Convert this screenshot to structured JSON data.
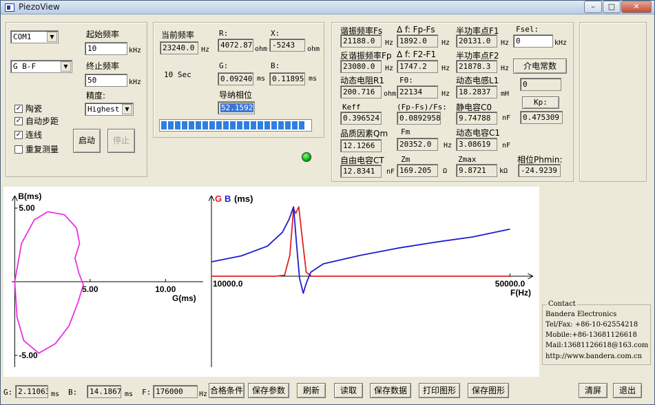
{
  "window": {
    "title": "PiezoView",
    "minimize": "–",
    "maximize": "□",
    "close": "✕"
  },
  "left": {
    "port": "COM1",
    "mode": "G B-F",
    "start_label": "起始频率",
    "start_value": "10",
    "start_unit": "kHz",
    "end_label": "终止频率",
    "end_value": "50",
    "end_unit": "kHz",
    "precision_label": "精度:",
    "precision_value": "Highest",
    "cb_ceramic": "陶瓷",
    "cb_autostep": "自动步距",
    "cb_connect": "连线",
    "cb_repeat": "重复测量",
    "cb_ceramic_checked": true,
    "cb_autostep_checked": true,
    "cb_connect_checked": true,
    "cb_repeat_checked": false,
    "start_button": "启动",
    "stop_button": "停止",
    "check_mark": "✓"
  },
  "middle": {
    "cur_freq_label": "当前频率",
    "cur_freq_value": "23240.0",
    "cur_freq_unit": "Hz",
    "r_label": "R:",
    "r_value": "4072.87",
    "r_unit": "ohm",
    "x_label": "X:",
    "x_value": "-5243",
    "x_unit": "ohm",
    "time_text": "10 Sec",
    "g_label": "G:",
    "g_value": "0.092403",
    "g_unit": "ms",
    "b_label": "B:",
    "b_value": "0.11895",
    "b_unit": "ms",
    "phase_label": "导纳相位",
    "phase_value": "52.1592",
    "progress_fraction": 1.0
  },
  "params": {
    "fs_label": "谐振频率Fs",
    "fs_value": "21188.0",
    "fs_unit": "Hz",
    "df1_label": "Δ f: Fp-Fs",
    "df1_value": "1892.0",
    "df1_unit": "Hz",
    "f1_label": "半功率点F1",
    "f1_value": "20131.0",
    "f1_unit": "Hz",
    "fsel_label": "Fsel:",
    "fsel_value": "0",
    "fsel_unit": "kHz",
    "fp_label": "反谐振频率Fp",
    "fp_value": "23080.0",
    "fp_unit": "Hz",
    "df2_label": "Δ f: F2-F1",
    "df2_value": "1747.2",
    "df2_unit": "Hz",
    "f2_label": "半功率点F2",
    "f2_value": "21878.3",
    "f2_unit": "Hz",
    "dielectric_button": "介电常数",
    "r1_label": "动态电阻R1",
    "r1_value": "200.716",
    "r1_unit": "ohm",
    "f0_label": "F0:",
    "f0_value": "22134",
    "f0_unit": "Hz",
    "l1_label": "动态电感L1",
    "l1_value": "18.2837",
    "l1_unit": "mH",
    "dielectric_value": "0",
    "keff_label": "Keff",
    "keff_value": "0.396524",
    "ratio_label": "(Fp-Fs)/Fs:",
    "ratio_value": "0.0892958",
    "c0_label": "静电容C0",
    "c0_value": "9.74788",
    "c0_unit": "nF",
    "kp_button": "Kp:",
    "kp_value": "0.475309",
    "qm_label": "品质因素Qm",
    "qm_value": "12.1266",
    "fm_label": "Fm",
    "fm_value": "20352.0",
    "fm_unit": "Hz",
    "c1_label": "动态电容C1",
    "c1_value": "3.08619",
    "c1_unit": "nF",
    "ct_label": "自由电容CT",
    "ct_value": "12.8341",
    "ct_unit": "nF",
    "zm_label": "Zm",
    "zm_value": "169.205",
    "zm_unit": "Ω",
    "zmax_label": "Zmax",
    "zmax_value": "9.8721",
    "zmax_unit": "kΩ",
    "phmin_label": "相位Phmin:",
    "phmin_value": "-24.9239"
  },
  "chart_data": [
    {
      "type": "line",
      "title": "",
      "xlabel": "G(ms)",
      "ylabel": "B(ms)",
      "xticks": [
        "5.00",
        "10.00"
      ],
      "yticks": [
        "5.00",
        "-5.00"
      ],
      "xlim": [
        -0.2,
        12.5
      ],
      "ylim": [
        -5.8,
        5.8
      ],
      "series": [
        {
          "color": "#ee2ee8",
          "points": [
            [
              0.0,
              0.0
            ],
            [
              0.45,
              2.6
            ],
            [
              1.3,
              4.2
            ],
            [
              2.2,
              4.75
            ],
            [
              3.3,
              4.55
            ],
            [
              4.1,
              3.65
            ],
            [
              4.3,
              2.6
            ],
            [
              4.0,
              1.6
            ],
            [
              4.25,
              0.6
            ],
            [
              4.55,
              -0.2
            ],
            [
              4.2,
              -1.4
            ],
            [
              3.6,
              -3.0
            ],
            [
              2.7,
              -4.2
            ],
            [
              1.6,
              -4.85
            ],
            [
              0.6,
              -4.0
            ],
            [
              0.15,
              -2.4
            ],
            [
              0.0,
              0.0
            ]
          ]
        }
      ]
    },
    {
      "type": "line",
      "title": "",
      "xlabel": "F(Hz)",
      "legend": [
        "G",
        "B",
        "(ms)"
      ],
      "xticks": [
        "10000.0",
        "50000.0"
      ],
      "xlim": [
        10000,
        53000
      ],
      "ylim": [
        -3.2,
        12
      ],
      "series": [
        {
          "name": "G",
          "color": "#e02020",
          "points": [
            [
              10000,
              0
            ],
            [
              18500,
              0
            ],
            [
              19800,
              0.15
            ],
            [
              20500,
              3.2
            ],
            [
              21000,
              10.3
            ],
            [
              21300,
              9.6
            ],
            [
              21700,
              10.6
            ],
            [
              22200,
              5.5
            ],
            [
              22700,
              0.6
            ],
            [
              23400,
              0
            ],
            [
              50000,
              0
            ]
          ]
        },
        {
          "name": "B",
          "color": "#1c1cd0",
          "points": [
            [
              10000,
              2.2
            ],
            [
              14000,
              3.1
            ],
            [
              17500,
              4.6
            ],
            [
              19500,
              6.7
            ],
            [
              20400,
              8.7
            ],
            [
              21000,
              10.6
            ],
            [
              21400,
              5.0
            ],
            [
              21800,
              -0.3
            ],
            [
              22300,
              -2.6
            ],
            [
              22700,
              -1.1
            ],
            [
              23300,
              0.6
            ],
            [
              25000,
              1.9
            ],
            [
              30000,
              3.2
            ],
            [
              35000,
              4.3
            ],
            [
              40000,
              5.2
            ],
            [
              45000,
              6.0
            ],
            [
              50000,
              7.2
            ]
          ]
        }
      ]
    }
  ],
  "contact": {
    "title": "Contact",
    "company": "Bandera Electronics",
    "tel": "Tel/Fax: +86-10-62554218",
    "mobile": "Mobile:+86-13681126618",
    "mail": "Mail:13681126618@163.com",
    "web": "http://www.bandera.com.cn"
  },
  "bottom": {
    "g_label": "G:",
    "g_value": "2.11063",
    "g_unit": "ms",
    "b_label": "B:",
    "b_value": "14.1867",
    "b_unit": "ms",
    "f_label": "F:",
    "f_value": "176000",
    "f_unit": "Hz",
    "buttons": [
      "合格条件",
      "保存参数",
      "刷新",
      "读取",
      "保存数据",
      "打印图形",
      "保存图形"
    ],
    "clear": "清屏",
    "exit": "退出"
  }
}
